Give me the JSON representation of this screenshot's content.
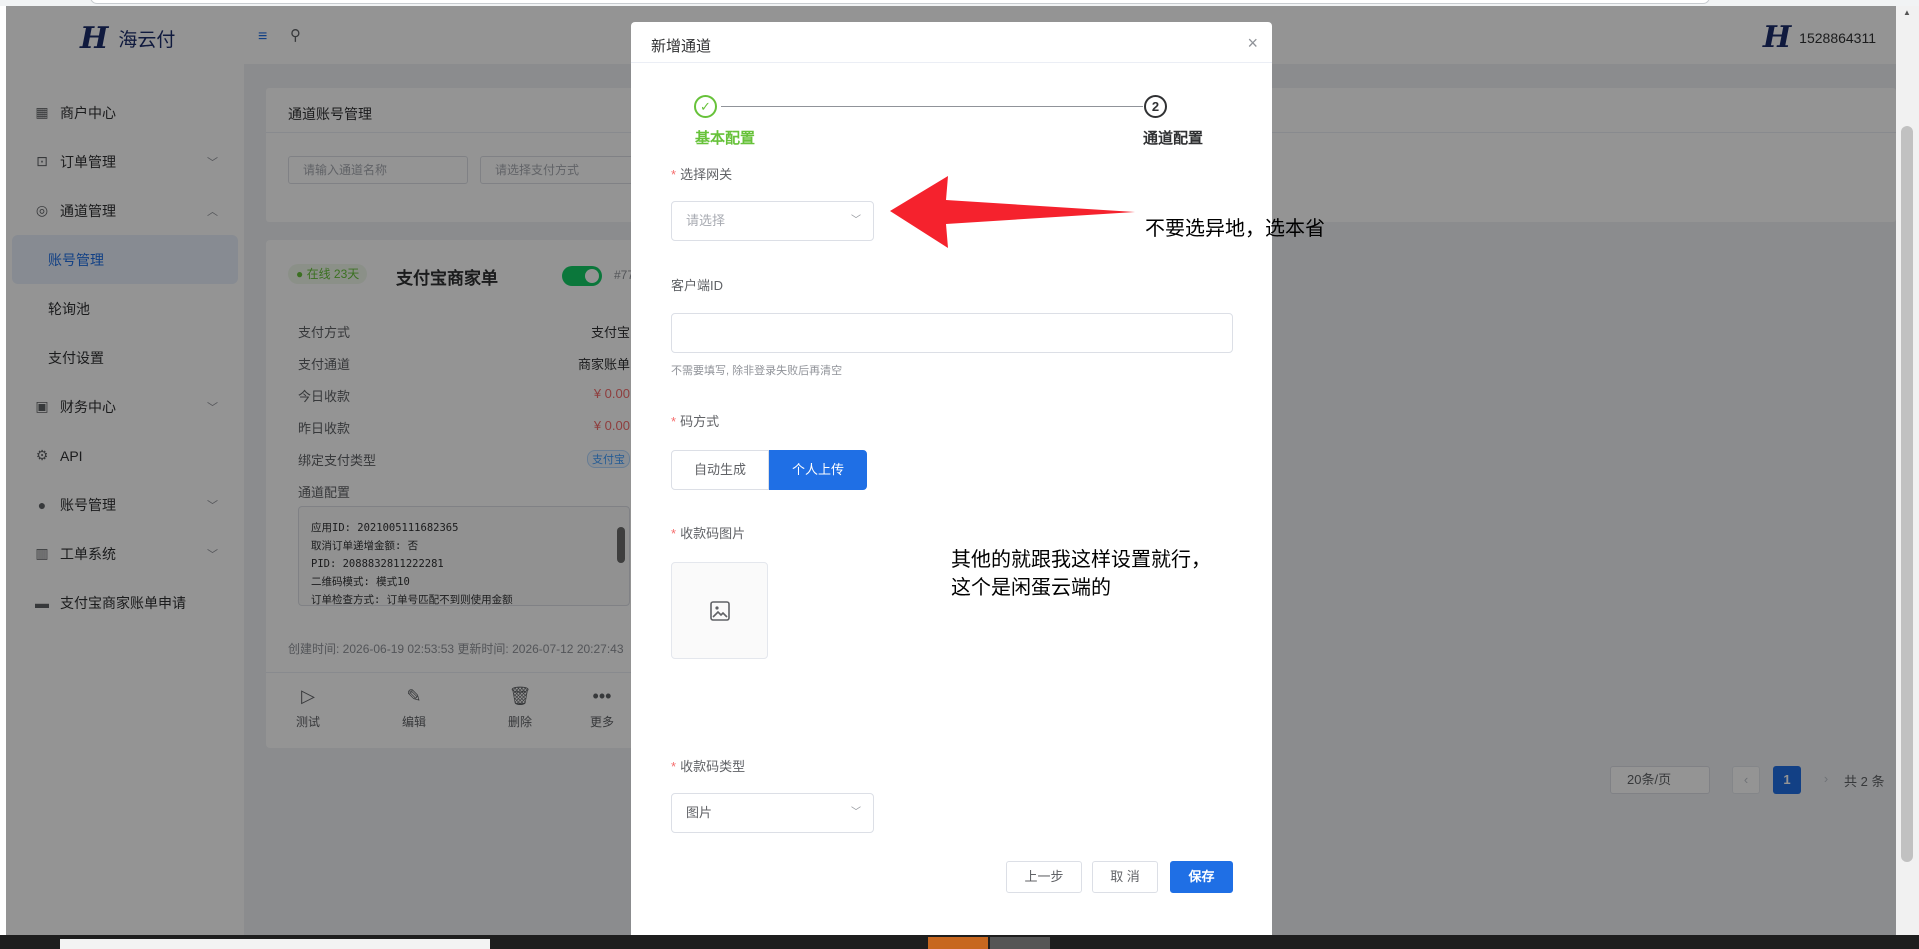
{
  "brand": {
    "name": "海云付"
  },
  "header": {
    "username": "1528864311"
  },
  "sidebar": {
    "items": [
      {
        "label": "商户中心",
        "icon": "grid-icon"
      },
      {
        "label": "订单管理",
        "icon": "bag-icon"
      },
      {
        "label": "通道管理",
        "icon": "channel-icon"
      },
      {
        "label": "账号管理",
        "sub": true,
        "active": true
      },
      {
        "label": "轮询池",
        "sub": true
      },
      {
        "label": "支付设置",
        "sub": true
      },
      {
        "label": "财务中心",
        "icon": "wallet-icon"
      },
      {
        "label": "API",
        "icon": "api-icon"
      },
      {
        "label": "账号管理",
        "icon": "user-icon"
      },
      {
        "label": "工单系统",
        "icon": "book-icon"
      },
      {
        "label": "支付宝商家账单申请",
        "icon": "card-icon"
      }
    ]
  },
  "page": {
    "title": "通道账号管理",
    "filter_name_placeholder": "请输入通道名称",
    "filter_pay_placeholder": "请选择支付方式"
  },
  "card": {
    "badge": "在线 23天",
    "title": "支付宝商家单",
    "tag_num": "#77",
    "rows": [
      {
        "label": "支付方式",
        "value": "支付宝"
      },
      {
        "label": "支付通道",
        "value": "商家账单"
      },
      {
        "label": "今日收款",
        "value": "¥ 0.00"
      },
      {
        "label": "昨日收款",
        "value": "¥ 0.00"
      },
      {
        "label": "绑定支付类型",
        "value": "支付宝"
      },
      {
        "label": "通道配置",
        "value": ""
      }
    ],
    "config_lines": [
      "应用ID: 2021005111682365",
      "取消订单递增金额: 否",
      "PID: 2088832811222281",
      "二维码模式: 模式10",
      "订单检查方式: 订单号匹配不到则使用金额"
    ],
    "meta": "创建时间: 2026-06-19 02:53:53 更新时间: 2026-07-12 20:27:43",
    "actions": [
      {
        "label": "测试",
        "icon": "play-icon"
      },
      {
        "label": "编辑",
        "icon": "edit-icon"
      },
      {
        "label": "删除",
        "icon": "trash-icon"
      },
      {
        "label": "更多",
        "icon": "more-icon"
      }
    ]
  },
  "pager": {
    "page_size": "20条/页",
    "current": "1",
    "total": "共 2 条"
  },
  "modal": {
    "title": "新增通道",
    "step1": "基本配置",
    "step2": "通道配置",
    "step2_num": "2",
    "gateway_label": "选择网关",
    "gateway_placeholder": "请选择",
    "client_id_label": "客户端ID",
    "client_id_hint": "不需要填写, 除非登录失败后再清空",
    "code_mode_label": "码方式",
    "code_mode_options": [
      "自动生成",
      "个人上传"
    ],
    "code_mode_selected": "个人上传",
    "qr_image_label": "收款码图片",
    "qr_type_label": "收款码类型",
    "qr_type_value": "图片",
    "btn_prev": "上一步",
    "btn_cancel": "取 消",
    "btn_save": "保存"
  },
  "annotations": {
    "arrow_note": "不要选异地，选本省",
    "note_line1": "其他的就跟我这样设置就行，",
    "note_line2": "这个是闲蛋云端的",
    "arrow_color": "#f5222d"
  }
}
